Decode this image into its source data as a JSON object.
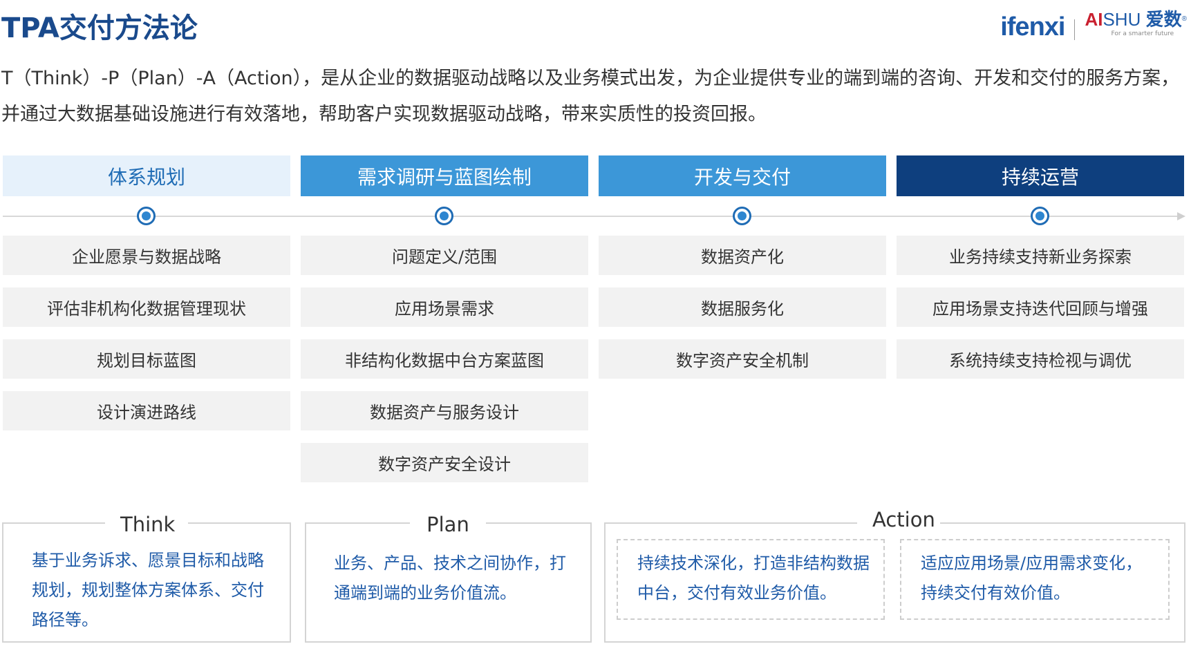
{
  "title": "TPA交付方法论",
  "logo": {
    "ifenxi": "ifenxi",
    "aishu_ai": "AI",
    "aishu_shu": "SHU",
    "aishu_cn": "爱数",
    "aishu_reg": "®",
    "slogan": "For a smarter future"
  },
  "description": "T（Think）-P（Plan）-A（Action），是从企业的数据驱动战略以及业务模式出发，为企业提供专业的端到端的咨询、开发和交付的服务方案，并通过大数据基础设施进行有效落地，帮助客户实现数据驱动战略，带来实质性的投资回报。",
  "colors": {
    "title": "#1a4a8c",
    "phase_light": "#e6f1fb",
    "phase_mid": "#3c97d8",
    "phase_dark": "#0e3f7e",
    "step_bg": "#f2f2f2",
    "box_text": "#1f5ba8"
  },
  "phases": [
    {
      "label": "体系规划",
      "steps": [
        "企业愿景与数据战略",
        "评估非机构化数据管理现状",
        "规划目标蓝图",
        "设计演进路线"
      ]
    },
    {
      "label": "需求调研与蓝图绘制",
      "steps": [
        "问题定义/范围",
        "应用场景需求",
        "非结构化数据中台方案蓝图",
        "数据资产与服务设计",
        "数字资产安全设计"
      ]
    },
    {
      "label": "开发与交付",
      "steps": [
        "数据资产化",
        "数据服务化",
        "数字资产安全机制"
      ]
    },
    {
      "label": "持续运营",
      "steps": [
        "业务持续支持新业务探索",
        "应用场景支持迭代回顾与增强",
        "系统持续支持检视与调优"
      ]
    }
  ],
  "tpa": {
    "think": {
      "title": "Think",
      "text": "基于业务诉求、愿景目标和战略规划，规划整体方案体系、交付路径等。"
    },
    "plan": {
      "title": "Plan",
      "text": "业务、产品、技术之间协作，打通端到端的业务价值流。"
    },
    "action": {
      "title": "Action",
      "items": [
        "持续技术深化，打造非结构数据中台，交付有效业务价值。",
        "适应应用场景/应用需求变化，持续交付有效价值。"
      ]
    }
  }
}
